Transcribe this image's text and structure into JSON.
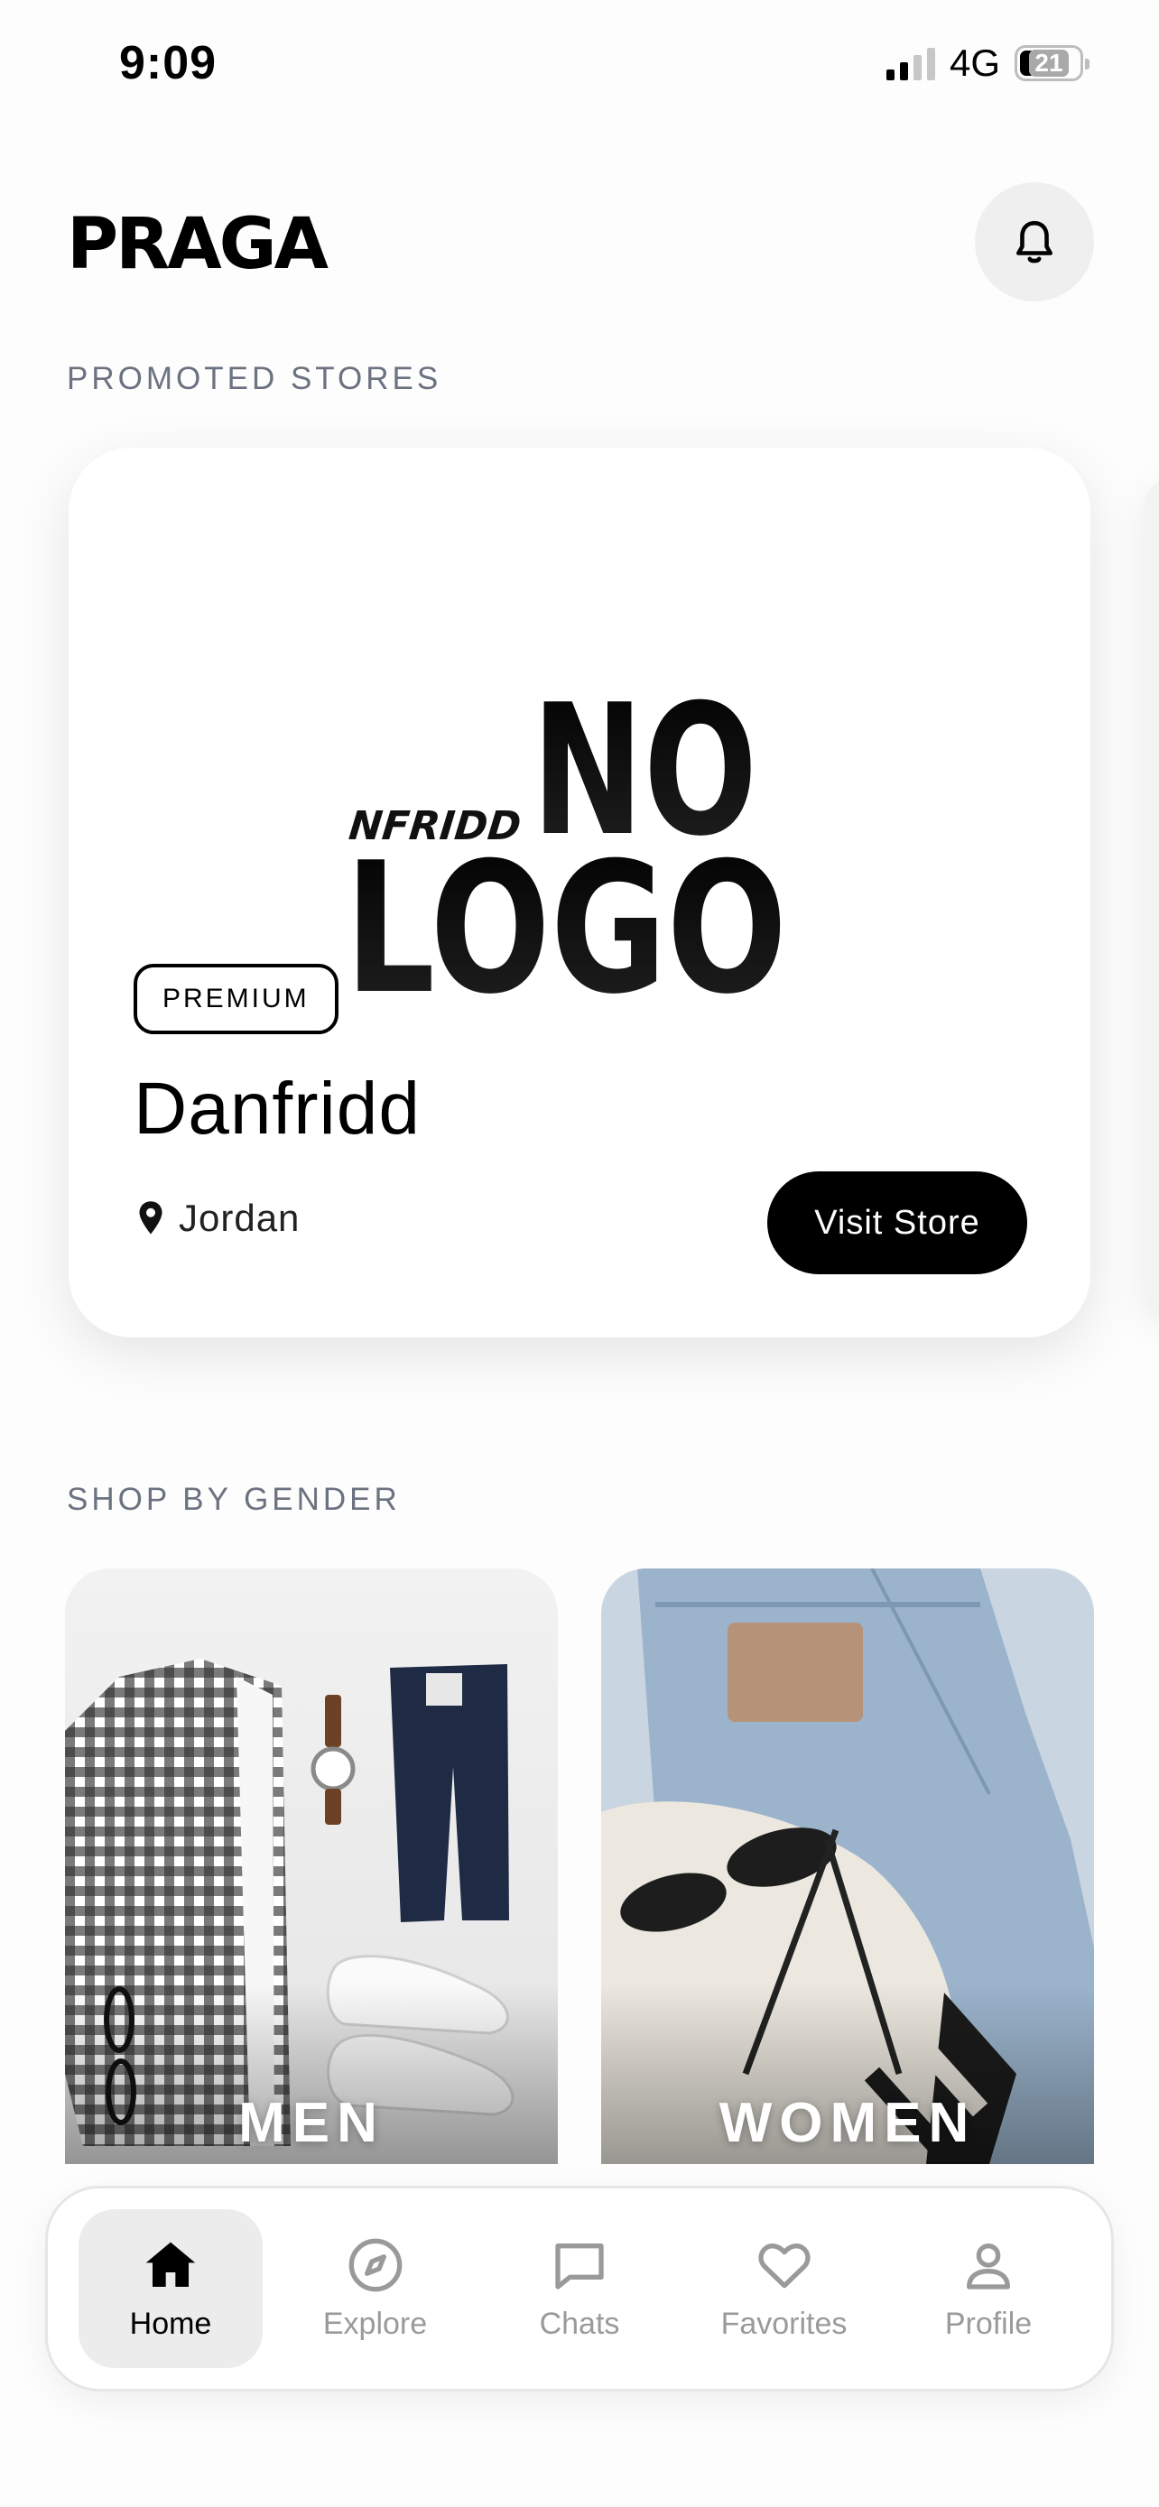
{
  "status_bar": {
    "time": "9:09",
    "network": "4G",
    "battery": "21"
  },
  "header": {
    "title": "PRAGA",
    "notifications_icon": "bell-icon"
  },
  "promoted": {
    "section_label": "PROMOTED STORES",
    "store": {
      "badge": "PREMIUM",
      "name": "Danfridd",
      "location": "Jordan",
      "visit_label": "Visit Store",
      "logo_text": [
        "DANFRIDD",
        "NO",
        "LOGO"
      ]
    }
  },
  "gender": {
    "section_label": "SHOP BY GENDER",
    "tiles": [
      {
        "label": "MEN"
      },
      {
        "label": "WOMEN"
      }
    ]
  },
  "tabs": [
    {
      "label": "Home",
      "icon": "home-icon",
      "active": true
    },
    {
      "label": "Explore",
      "icon": "compass-icon",
      "active": false
    },
    {
      "label": "Chats",
      "icon": "chat-icon",
      "active": false
    },
    {
      "label": "Favorites",
      "icon": "heart-icon",
      "active": false
    },
    {
      "label": "Profile",
      "icon": "user-icon",
      "active": false
    }
  ],
  "colors": {
    "accent": "#000000",
    "section_label": "#6b7280",
    "inactive_tab": "#9a9a9a",
    "active_tab_bg": "#ececec"
  }
}
